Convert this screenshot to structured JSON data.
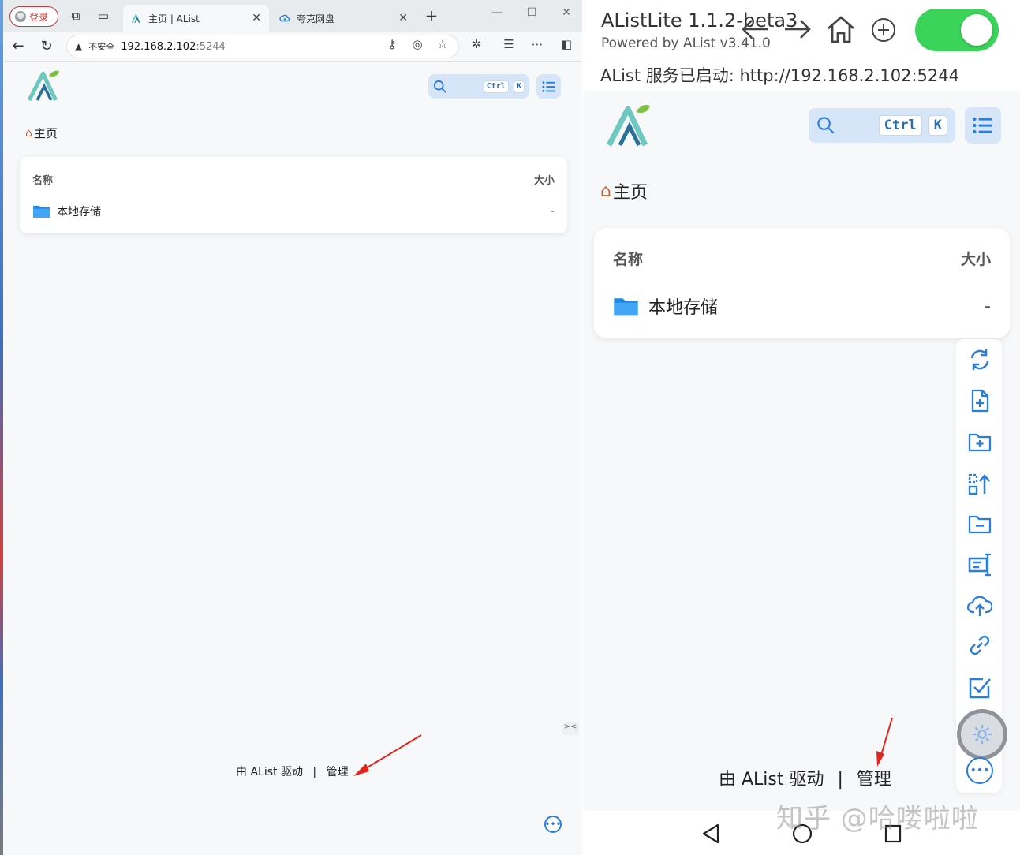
{
  "browser": {
    "profile_label": "登录",
    "tabs": [
      {
        "label": "主页 | AList",
        "close": "✕"
      },
      {
        "label": "夸克网盘",
        "close": "✕"
      }
    ],
    "new_tab": "+",
    "window_controls": {
      "minimize": "—",
      "maximize": "☐",
      "close": "✕"
    },
    "address": {
      "security_label": "不安全",
      "host": "192.168.2.102",
      "port": ":5244"
    }
  },
  "alist_web": {
    "search_kbd": [
      "Ctrl",
      "K"
    ],
    "breadcrumb": "主页",
    "table": {
      "col_name": "名称",
      "col_size": "大小",
      "rows": [
        {
          "name": "本地存储",
          "size": "-"
        }
      ]
    },
    "footer": {
      "powered": "由 AList 驱动",
      "separator": "|",
      "manage": "管理"
    }
  },
  "app": {
    "title": "AListLite 1.1.2-beta3",
    "subtitle": "Powered by AList v3.41.0",
    "status": "AList 服务已启动: http://192.168.2.102:5244",
    "service_enabled": true,
    "search_kbd": [
      "Ctrl",
      "K"
    ],
    "breadcrumb": "主页",
    "table": {
      "col_name": "名称",
      "col_size": "大小",
      "rows": [
        {
          "name": "本地存储",
          "size": "-"
        }
      ]
    },
    "toolbar_icons": [
      "refresh-icon",
      "new-file-icon",
      "new-folder-icon",
      "recursive-move-icon",
      "remove-empty-folder-icon",
      "batch-rename-icon",
      "upload-icon",
      "offline-download-icon",
      "select-all-icon",
      "settings-icon",
      "more-icon"
    ],
    "footer": {
      "powered": "由 AList 驱动",
      "separator": "|",
      "manage": "管理"
    }
  },
  "watermark": "知乎 @哈喽啦啦",
  "colors": {
    "accent": "#2b7de0",
    "toggle_on": "#3bd35a",
    "arrow": "#e0261e",
    "folder": "#2196f3"
  }
}
